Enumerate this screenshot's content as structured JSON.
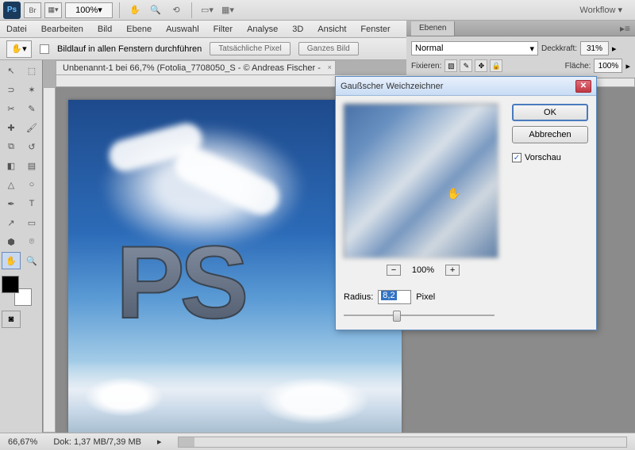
{
  "topbar": {
    "br_label": "Br",
    "zoom": "100%",
    "workflow": "Workflow"
  },
  "menu": {
    "items": [
      "Datei",
      "Bearbeiten",
      "Bild",
      "Ebene",
      "Auswahl",
      "Filter",
      "Analyse",
      "3D",
      "Ansicht",
      "Fenster"
    ]
  },
  "optionsbar": {
    "scroll_all": "Bildlauf in allen Fenstern durchführen",
    "actual_pixels": "Tatsächliche Pixel",
    "fit_screen": "Ganzes Bild"
  },
  "document": {
    "tab_title": "Unbenannt-1 bei 66,7% (Fotolia_7708050_S - © Andreas Fischer -",
    "canvas_text": "PS"
  },
  "statusbar": {
    "zoom": "66,67%",
    "doc_size": "Dok: 1,37 MB/7,39 MB"
  },
  "layers_panel": {
    "tab": "Ebenen",
    "blend_mode": "Normal",
    "opacity_label": "Deckkraft:",
    "opacity": "31%",
    "lock_label": "Fixieren:",
    "fill_label": "Fläche:",
    "fill": "100%"
  },
  "dialog": {
    "title": "Gaußscher Weichzeichner",
    "ok": "OK",
    "cancel": "Abbrechen",
    "preview": "Vorschau",
    "zoom_level": "100%",
    "radius_label": "Radius:",
    "radius_value": "8,2",
    "radius_unit": "Pixel",
    "minus": "−",
    "plus": "+"
  }
}
